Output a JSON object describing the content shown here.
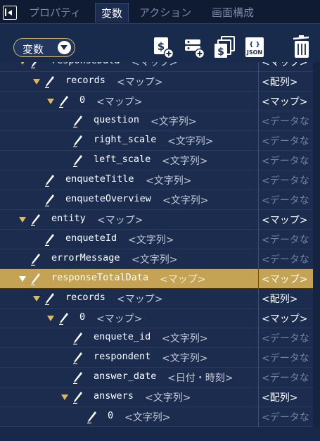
{
  "tabs": [
    {
      "label": "プロパティ",
      "active": false
    },
    {
      "label": "変数",
      "active": true
    },
    {
      "label": "アクション",
      "active": false
    },
    {
      "label": "画面構成",
      "active": false
    }
  ],
  "toolbar": {
    "dropdown_label": "変数",
    "icons": [
      "add-string-variable-icon",
      "add-database-variable-icon",
      "add-map-variable-icon",
      "json-import-icon",
      "trash-icon"
    ],
    "json_label": "JSON"
  },
  "tree": {
    "rows": [
      {
        "name": "responseData",
        "type": "<マップ>",
        "value": "<マップ>",
        "placeholder": false,
        "caret": true,
        "level": 0
      },
      {
        "name": "records",
        "type": "<マップ>",
        "value": "<配列>",
        "placeholder": false,
        "caret": true,
        "level": 1
      },
      {
        "name": "0",
        "type": "<マップ>",
        "value": "<マップ>",
        "placeholder": false,
        "caret": true,
        "level": 2
      },
      {
        "name": "question",
        "type": "<文字列>",
        "value": "<データな",
        "placeholder": true,
        "caret": false,
        "level": 3
      },
      {
        "name": "right_scale",
        "type": "<文字列>",
        "value": "<データな",
        "placeholder": true,
        "caret": false,
        "level": 3
      },
      {
        "name": "left_scale",
        "type": "<文字列>",
        "value": "<データな",
        "placeholder": true,
        "caret": false,
        "level": 3
      },
      {
        "name": "enqueteTitle",
        "type": "<文字列>",
        "value": "<データな",
        "placeholder": true,
        "caret": false,
        "level": 1
      },
      {
        "name": "enqueteOverview",
        "type": "<文字列>",
        "value": "<データな",
        "placeholder": true,
        "caret": false,
        "level": 1
      },
      {
        "name": "entity",
        "type": "<マップ>",
        "value": "<マップ>",
        "placeholder": false,
        "caret": true,
        "level": 0
      },
      {
        "name": "enqueteId",
        "type": "<文字列>",
        "value": "<データな",
        "placeholder": true,
        "caret": false,
        "level": 1
      },
      {
        "name": "errorMessage",
        "type": "<文字列>",
        "value": "<データな",
        "placeholder": true,
        "caret": false,
        "level": 0
      },
      {
        "name": "responseTotalData",
        "type": "<マップ>",
        "value": "<マップ>",
        "placeholder": false,
        "caret": true,
        "level": 0,
        "selected": true
      },
      {
        "name": "records",
        "type": "<マップ>",
        "value": "<配列>",
        "placeholder": false,
        "caret": true,
        "level": 1
      },
      {
        "name": "0",
        "type": "<マップ>",
        "value": "<マップ>",
        "placeholder": false,
        "caret": true,
        "level": 2
      },
      {
        "name": "enquete_id",
        "type": "<文字列>",
        "value": "<データな",
        "placeholder": true,
        "caret": false,
        "level": 3
      },
      {
        "name": "respondent",
        "type": "<文字列>",
        "value": "<データな",
        "placeholder": true,
        "caret": false,
        "level": 3
      },
      {
        "name": "answer_date",
        "type": "<日付・時刻>",
        "value": "<データな",
        "placeholder": true,
        "caret": false,
        "level": 3
      },
      {
        "name": "answers",
        "type": "<文字列>",
        "value": "<配列>",
        "placeholder": false,
        "caret": true,
        "level": 3
      },
      {
        "name": "0",
        "type": "<文字列>",
        "value": "<データな",
        "placeholder": true,
        "caret": false,
        "level": 4
      }
    ]
  },
  "colors": {
    "background": "#1b2c4f",
    "selected_row": "#c4a354",
    "caret": "#d8b96b",
    "placeholder_text": "#7283a3"
  }
}
